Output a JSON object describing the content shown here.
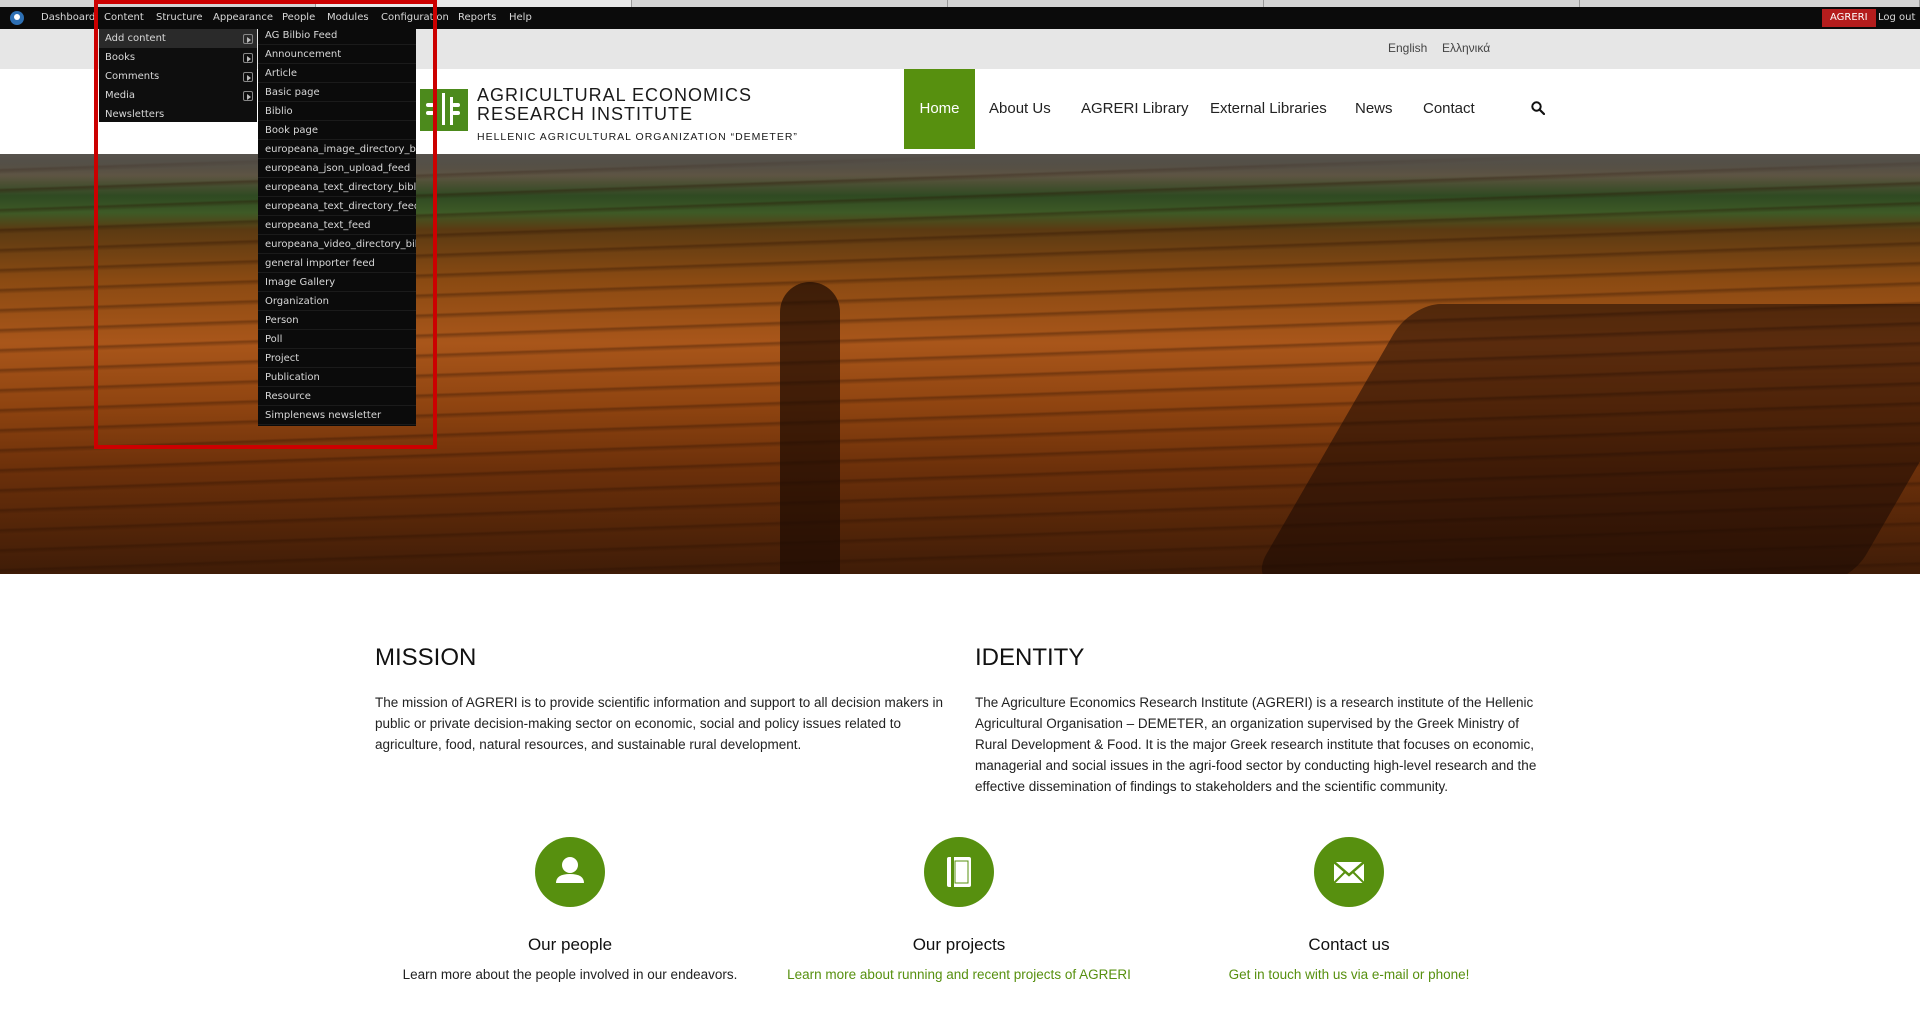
{
  "admin_bar": {
    "items": [
      "Dashboard",
      "Content",
      "Structure",
      "Appearance",
      "People",
      "Modules",
      "Configuration",
      "Reports",
      "Help"
    ],
    "site_badge": "AGRERI",
    "logout": "Log out"
  },
  "content_menu": {
    "items": [
      {
        "label": "Add content",
        "has_submenu": true
      },
      {
        "label": "Books",
        "has_submenu": true
      },
      {
        "label": "Comments",
        "has_submenu": true
      },
      {
        "label": "Media",
        "has_submenu": true
      },
      {
        "label": "Newsletters",
        "has_submenu": false
      }
    ]
  },
  "add_content_submenu": {
    "items": [
      "AG Bilbio Feed",
      "Announcement",
      "Article",
      "Basic page",
      "Biblio",
      "Book page",
      "europeana_image_directory_biblio",
      "europeana_json_upload_feed",
      "europeana_text_directory_biblio",
      "europeana_text_directory_feed",
      "europeana_text_feed",
      "europeana_video_directory_biblio",
      "general importer feed",
      "Image Gallery",
      "Organization",
      "Person",
      "Poll",
      "Project",
      "Publication",
      "Resource",
      "Simplenews newsletter"
    ]
  },
  "languages": [
    "English",
    "Ελληνικά"
  ],
  "brand": {
    "title_line1": "AGRICULTURAL ECONOMICS",
    "title_line2": "RESEARCH INSTITUTE",
    "subtitle": "HELLENIC AGRICULTURAL ORGANIZATION “DEMETER”"
  },
  "nav": {
    "items": [
      "Home",
      "About Us",
      "AGRERI Library",
      "External Libraries",
      "News",
      "Contact"
    ],
    "active": "Home"
  },
  "mission": {
    "title": "MISSION",
    "text": "The mission of AGRERI is to provide scientific information and support to all decision makers in public or private decision-making sector on economic, social and policy issues related to agriculture, food, natural resources, and sustainable rural development."
  },
  "identity": {
    "title": "IDENTITY",
    "text": "The Agriculture Economics Research Institute (AGRERI) is a research institute of the Hellenic Agricultural Organisation – DEMETER, an organization supervised by the Greek Ministry of Rural Development & Food. It is the major Greek research institute that focuses on economic, managerial and social issues in the agri-food sector by conducting high-level research and the effective dissemination of findings to stakeholders and the scientific community."
  },
  "features": [
    {
      "icon": "person-icon",
      "title": "Our people",
      "text": "Learn more about the people involved in our endeavors."
    },
    {
      "icon": "book-icon",
      "title": "Our projects",
      "text": "Learn more about running and recent projects of AGRERI"
    },
    {
      "icon": "envelope-icon",
      "title": "Contact us",
      "text": "Get in touch with us via e-mail or phone!"
    }
  ],
  "colors": {
    "accent_green": "#57900f",
    "admin_bar": "#0b0b0b",
    "site_badge": "#b41d1d",
    "highlight": "#cc0000"
  }
}
